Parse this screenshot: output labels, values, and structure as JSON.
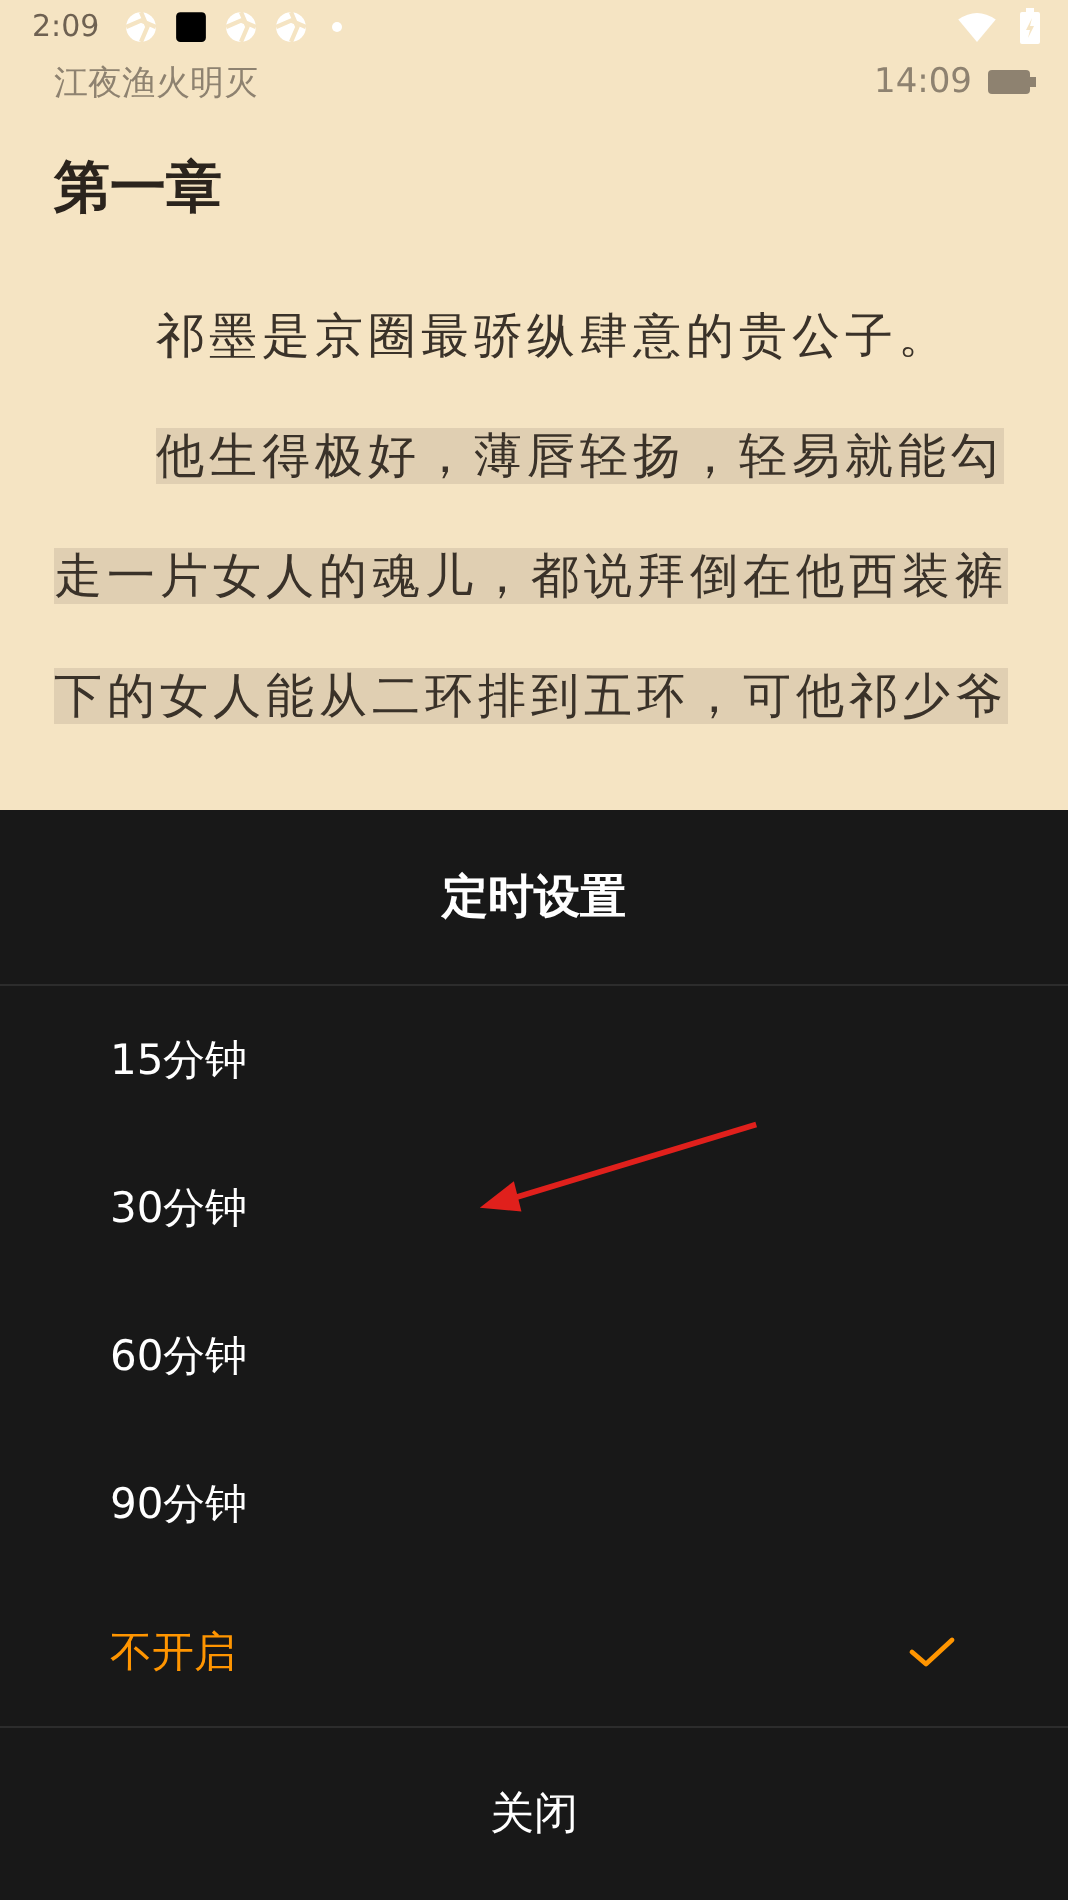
{
  "status_bar": {
    "time": "2:09"
  },
  "reader": {
    "book_title": "江夜渔火明灭",
    "clock": "14:09",
    "chapter_title": "第一章",
    "paragraphs": [
      {
        "text": "祁墨是京圈最骄纵肆意的贵公子。",
        "highlighted": false
      },
      {
        "text": "他生得极好，薄唇轻扬，轻易就能勾走一片女人的魂儿，都说拜倒在他西装裤下的女人能从二环排到五环，可他祁少爷",
        "highlighted": true
      }
    ]
  },
  "timer_sheet": {
    "title": "定时设置",
    "options": [
      {
        "label": "15分钟",
        "selected": false
      },
      {
        "label": "30分钟",
        "selected": false
      },
      {
        "label": "60分钟",
        "selected": false
      },
      {
        "label": "90分钟",
        "selected": false
      },
      {
        "label": "不开启",
        "selected": true
      }
    ],
    "close_button": "关闭"
  }
}
